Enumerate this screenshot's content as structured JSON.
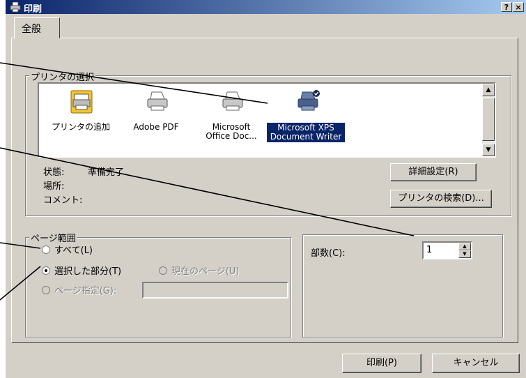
{
  "window": {
    "title": "印刷",
    "help_label": "?",
    "close_label": "×"
  },
  "tabs": [
    {
      "label": "全般"
    }
  ],
  "printer_group": {
    "legend": "プリンタの選択",
    "printers": [
      {
        "name": "プリンタの追加",
        "icon": "add-printer-icon"
      },
      {
        "name": "Adobe PDF",
        "icon": "printer-icon"
      },
      {
        "name": "Microsoft Office Doc...",
        "icon": "printer-icon"
      },
      {
        "name": "Microsoft XPS Document Writer",
        "icon": "default-printer-icon",
        "selected": true
      }
    ],
    "status_label": "状態:",
    "status_value": "準備完了",
    "location_label": "場所:",
    "comment_label": "コメント:",
    "advanced_button": "詳細設定(R)",
    "find_printer_button": "プリンタの検索(D)..."
  },
  "page_range": {
    "legend": "ページ範囲",
    "all_label": "すべて(L)",
    "selection_label": "選択した部分(T)",
    "current_page_label": "現在のページ(U)",
    "pages_label": "ページ指定(G):",
    "pages_value": "",
    "selected_option": "selection"
  },
  "copies": {
    "label": "部数(C):",
    "value": "1"
  },
  "footer": {
    "print_button": "印刷(P)",
    "cancel_button": "キャンセル"
  },
  "colors": {
    "title_start": "#0a246a",
    "title_end": "#a6caf0",
    "selection": "#0a246a",
    "face": "#d4d0c8"
  }
}
